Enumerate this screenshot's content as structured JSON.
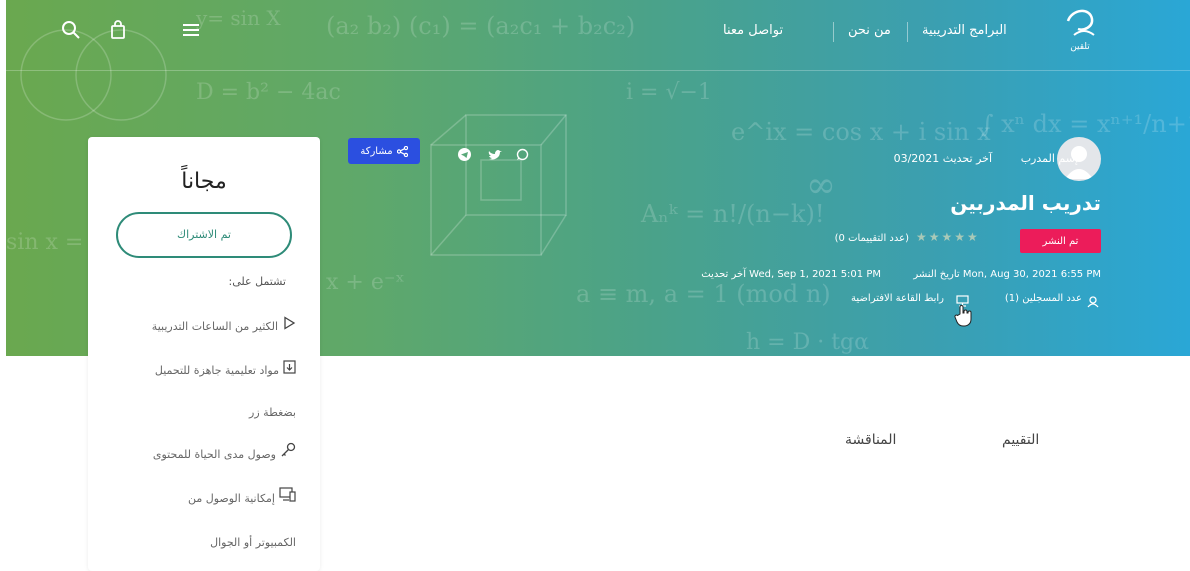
{
  "nav": {
    "programs": "البرامج التدريبية",
    "about": "من نحن",
    "contact": "تواصل معنا"
  },
  "course": {
    "trainer_label": "إسم المدرب",
    "updated_short": "آخر تحديث 03/2021",
    "title": "تدريب المدربين",
    "status_badge": "تم النشر",
    "ratings": "(0 عدد التقييمات)",
    "published": "تاريخ النشر Mon, Aug 30, 2021 6:55 PM",
    "updated": "آخر تحديث Wed, Sep 1, 2021 5:01 PM",
    "enrolled": "عدد المسجلين (1)",
    "virtual_room": "رابط القاعة الافتراضية"
  },
  "share": {
    "label": "مشاركة"
  },
  "card": {
    "price": "مجاناً",
    "subscribe": "تم الاشتراك",
    "includes": "تشتمل على:",
    "features": [
      {
        "text": "الكثير من الساعات التدريبية",
        "icon": "play-icon"
      },
      {
        "text": "مواد تعليمية جاهزة للتحميل",
        "icon": "download-file-icon"
      },
      {
        "text": "بضغطة زر",
        "icon": ""
      },
      {
        "text": "وصول مدى الحياة للمحتوى",
        "icon": "key-icon"
      },
      {
        "text": "إمكانية الوصول من",
        "icon": "devices-icon"
      },
      {
        "text": "الكمبيوتر أو الجوال",
        "icon": ""
      }
    ]
  },
  "tabs": {
    "rating": "التقييم",
    "discussion": "المناقشة"
  },
  "colors": {
    "accent": "#2e8b78",
    "badge": "#ec1c5a",
    "share": "#2b4fe0"
  }
}
